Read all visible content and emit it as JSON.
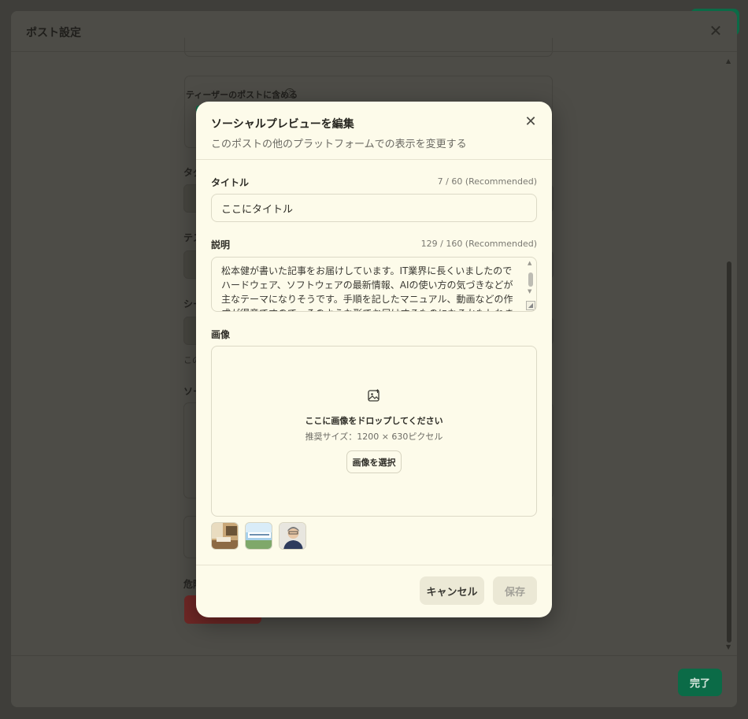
{
  "outer_modal": {
    "title": "ポスト設定",
    "teaser_label": "ティーザーのポストに含める",
    "done_label": "完了",
    "fragments": [
      "タグ",
      "テス",
      "シー",
      "この",
      "ソー",
      "危険"
    ]
  },
  "dialog": {
    "title": "ソーシャルプレビューを編集",
    "subtitle": "このポストの他のプラットフォームでの表示を変更する",
    "title_field": {
      "label": "タイトル",
      "counter": "7 / 60 (Recommended)",
      "value": "ここにタイトル"
    },
    "description_field": {
      "label": "説明",
      "counter": "129 / 160 (Recommended)",
      "value": "松本健が書いた記事をお届けしています。IT業界に長くいましたのでハードウェア、ソフトウェアの最新情報、AIの使い方の気づきなどが主なテーマになりそうです。手順を記したマニュアル、動画などの作成が得意ですので、そのような形でお届けするものになるかもしれません。"
    },
    "image_field": {
      "label": "画像",
      "drop_text": "ここに画像をドロップしてください",
      "recommended_size": "推奨サイズ：1200 × 630ピクセル",
      "select_label": "画像を選択",
      "icon": "image-upload-icon"
    },
    "thumbnails": [
      "thumbnail-desk-photo",
      "thumbnail-banner",
      "thumbnail-avatar-illustration"
    ],
    "cancel_label": "キャンセル",
    "save_label": "保存"
  },
  "colors": {
    "accent_green": "#0b6b47",
    "dialog_bg": "#fdfbea",
    "danger_red": "#6e2725"
  }
}
